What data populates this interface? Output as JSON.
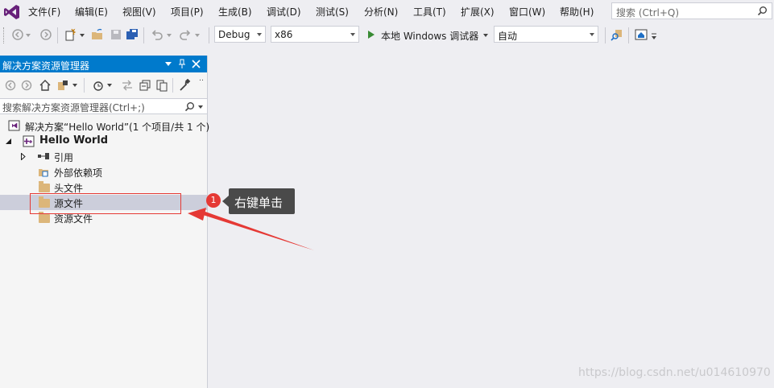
{
  "menu": {
    "items": [
      "文件(F)",
      "编辑(E)",
      "视图(V)",
      "项目(P)",
      "生成(B)",
      "调试(D)",
      "测试(S)",
      "分析(N)",
      "工具(T)",
      "扩展(X)",
      "窗口(W)",
      "帮助(H)"
    ]
  },
  "search": {
    "placeholder": "搜索 (Ctrl+Q)"
  },
  "toolbar": {
    "configuration": "Debug",
    "platform": "x86",
    "run_label": "本地 Windows 调试器",
    "auto": "自动"
  },
  "solution_explorer": {
    "title": "解决方案资源管理器",
    "search_placeholder": "搜索解决方案资源管理器(Ctrl+;)",
    "solution": "解决方案“Hello World”(1 个项目/共 1 个)",
    "project": "Hello World",
    "items": [
      "引用",
      "外部依赖项",
      "头文件",
      "源文件",
      "资源文件"
    ]
  },
  "annotation": {
    "number": "1",
    "text": "右键单击"
  },
  "watermark": "https://blog.csdn.net/u014610970",
  "colors": {
    "accent": "#007acc",
    "highlight": "#e53935",
    "callout_bg": "#4a4a4a"
  }
}
